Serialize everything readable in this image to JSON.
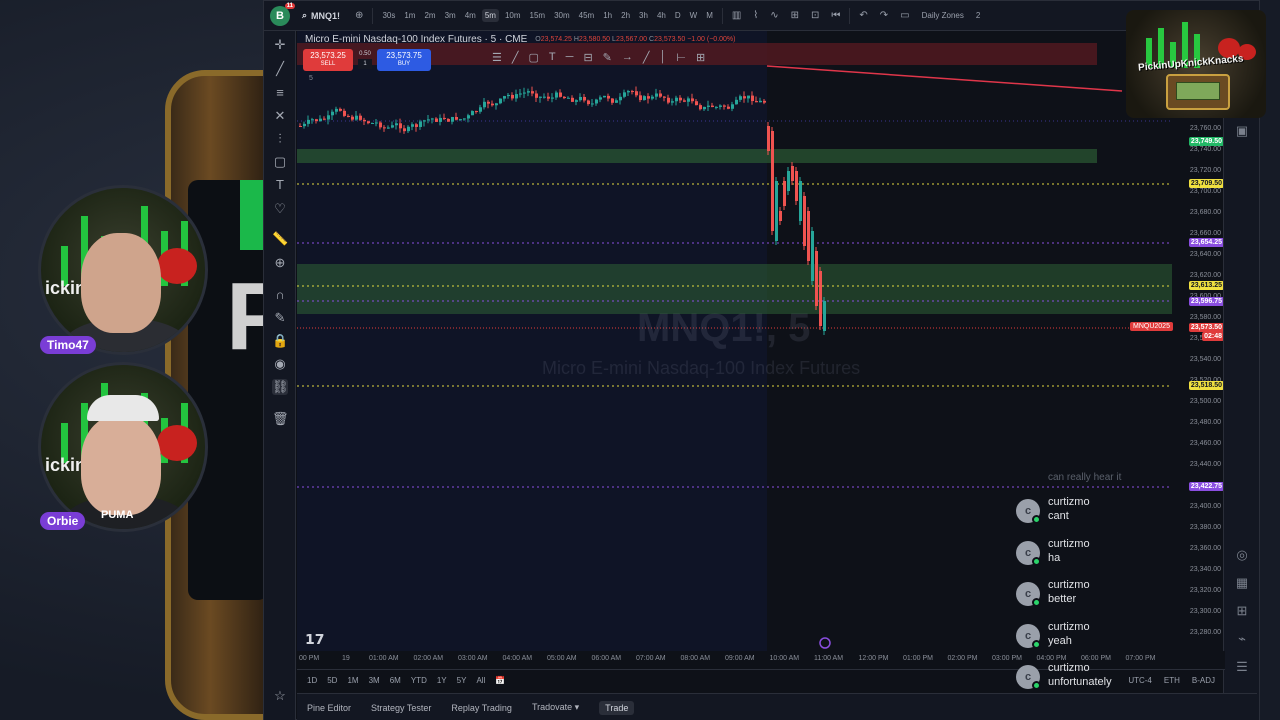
{
  "backdrop": {
    "letter": "P"
  },
  "webcams": [
    {
      "name": "Timo47",
      "brand": "ickin"
    },
    {
      "name": "Orbie",
      "brand": "ickin",
      "shirt_text": "PUMA"
    }
  ],
  "brand_logo": {
    "text": "PickinUpKnickKnacks"
  },
  "topbar": {
    "logo_letter": "B",
    "notification_count": "11",
    "symbol": "MNQ1!",
    "intervals": [
      "30s",
      "1m",
      "2m",
      "3m",
      "4m",
      "5m",
      "10m",
      "15m",
      "30m",
      "45m",
      "1h",
      "2h",
      "3h",
      "4h",
      "D",
      "W",
      "M"
    ],
    "active_interval": "5m",
    "timezone_label": "Daily Zones",
    "badge_count": "2"
  },
  "chart": {
    "title": "Micro E-mini Nasdaq-100 Index Futures · 5 · CME",
    "ohlc": {
      "o": "23,574.25",
      "h": "23,580.50",
      "l": "23,567.00",
      "c": "23,573.50",
      "change": "−1.00 (−0.00%)"
    },
    "sell": {
      "price": "23,573.25",
      "label": "SELL"
    },
    "buy": {
      "price": "23,573.75",
      "label": "BUY"
    },
    "spread": {
      "value": "0.50",
      "qty": "1"
    },
    "interval_tag": "5",
    "watermark_symbol": "MNQ1!, 5",
    "watermark_desc": "Micro E-mini Nasdaq-100 Index Futures",
    "price_axis": [
      "23,760.00",
      "23,740.00",
      "23,720.00",
      "23,700.00",
      "23,680.00",
      "23,660.00",
      "23,640.00",
      "23,620.00",
      "23,600.00",
      "23,580.00",
      "23,560.00",
      "23,540.00",
      "23,520.00",
      "23,500.00",
      "23,480.00",
      "23,460.00",
      "23,440.00",
      "23,420.00",
      "23,400.00",
      "23,380.00",
      "23,360.00",
      "23,340.00",
      "23,320.00",
      "23,300.00",
      "23,280.00"
    ],
    "price_tags": [
      {
        "text": "23,749.50",
        "color": "#22b866"
      },
      {
        "text": "23,709.50",
        "color": "#f0e040"
      },
      {
        "text": "23,654.25",
        "color": "#8a4ee0"
      },
      {
        "text": "23,613.25",
        "color": "#f0e040"
      },
      {
        "text": "23,596.75",
        "color": "#8a4ee0"
      },
      {
        "text": "23,573.50",
        "color": "#e03b3b"
      },
      {
        "text": "02:48",
        "color": "#e03b3b"
      },
      {
        "text": "23,518.50",
        "color": "#f0e040"
      },
      {
        "text": "23,422.75",
        "color": "#8a4ee0"
      }
    ],
    "contract_tag": "MNQU2025",
    "time_axis": [
      "00 PM",
      "19",
      "01:00 AM",
      "02:00 AM",
      "03:00 AM",
      "04:00 AM",
      "05:00 AM",
      "06:00 AM",
      "07:00 AM",
      "08:00 AM",
      "09:00 AM",
      "10:00 AM",
      "11:00 AM",
      "12:00 PM",
      "01:00 PM",
      "02:00 PM",
      "03:00 PM",
      "04:00 PM",
      "06:00 PM",
      "07:00 PM"
    ]
  },
  "bottom_ranges": [
    "1D",
    "5D",
    "1M",
    "3M",
    "6M",
    "YTD",
    "1Y",
    "5Y",
    "All"
  ],
  "bottom_right": [
    "UTC-4",
    "ETH",
    "B-ADJ"
  ],
  "footer_tabs": [
    "Pine Editor",
    "Strategy Tester",
    "Replay Trading",
    "Tradovate ▾",
    "Trade"
  ],
  "chat": {
    "faded_text": "can really hear it",
    "messages": [
      {
        "user": "curtizmo",
        "text": "cant"
      },
      {
        "user": "curtizmo",
        "text": "ha"
      },
      {
        "user": "curtizmo",
        "text": "better"
      },
      {
        "user": "curtizmo",
        "text": "yeah"
      },
      {
        "user": "curtizmo",
        "text": "unfortunately"
      }
    ]
  },
  "colors": {
    "up": "#26a69a",
    "down": "#ef5350",
    "zone_green": "#2e6b3a",
    "background": "#0e1118"
  }
}
